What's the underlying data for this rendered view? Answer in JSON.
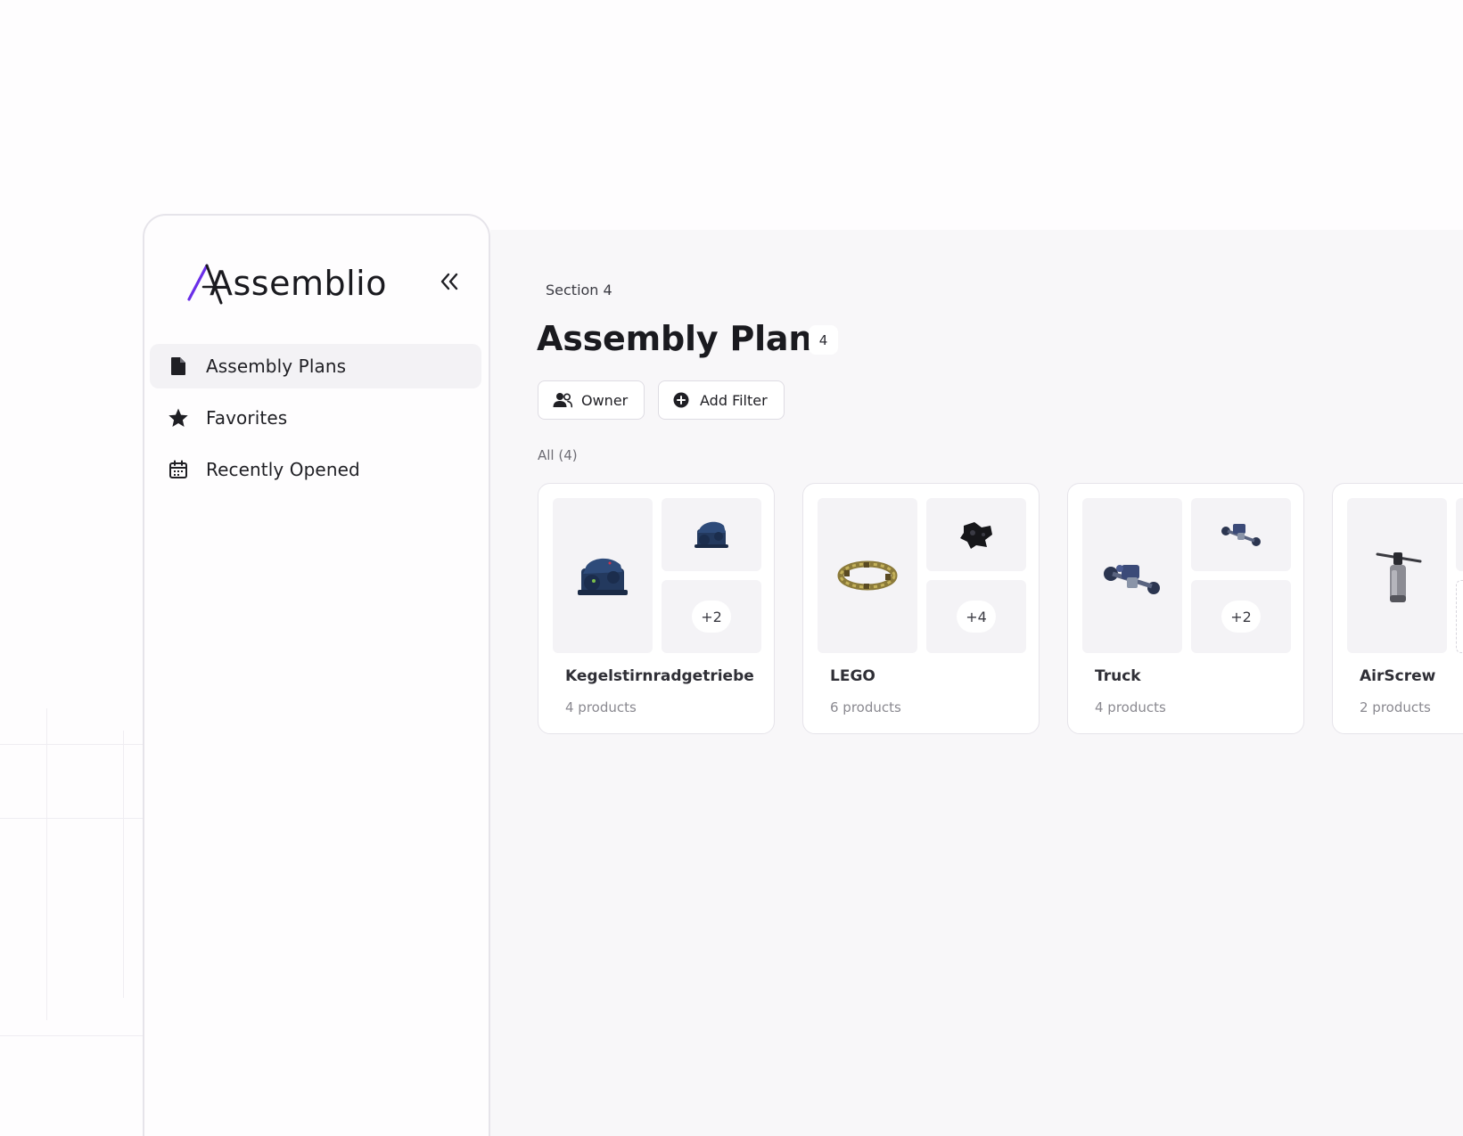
{
  "app": {
    "logo_text": "Assemblio",
    "brand_color": "#6a2ee8"
  },
  "sidebar": {
    "collapse_icon": "double-chevron-left-icon",
    "items": [
      {
        "label": "Assembly Plans",
        "icon": "file-icon",
        "active": true
      },
      {
        "label": "Favorites",
        "icon": "star-icon",
        "active": false
      },
      {
        "label": "Recently Opened",
        "icon": "calendar-icon",
        "active": false
      }
    ]
  },
  "header": {
    "breadcrumb": "Section 4",
    "title": "Assembly Plans",
    "count": "4"
  },
  "filters": {
    "owner_label": "Owner",
    "add_filter_label": "Add Filter"
  },
  "list": {
    "section_label": "All (4)",
    "cards": [
      {
        "name": "Kegelstirnradgetriebe",
        "subtitle": "4 products",
        "more": "+2",
        "thumb": "gearbox-image"
      },
      {
        "name": "LEGO",
        "subtitle": "6 products",
        "more": "+4",
        "thumb": "lego-ring-image"
      },
      {
        "name": "Truck",
        "subtitle": "4 products",
        "more": "+2",
        "thumb": "truck-axle-image"
      },
      {
        "name": "AirScrew",
        "subtitle": "2 products",
        "more": "",
        "thumb": "airscrew-image"
      }
    ]
  }
}
